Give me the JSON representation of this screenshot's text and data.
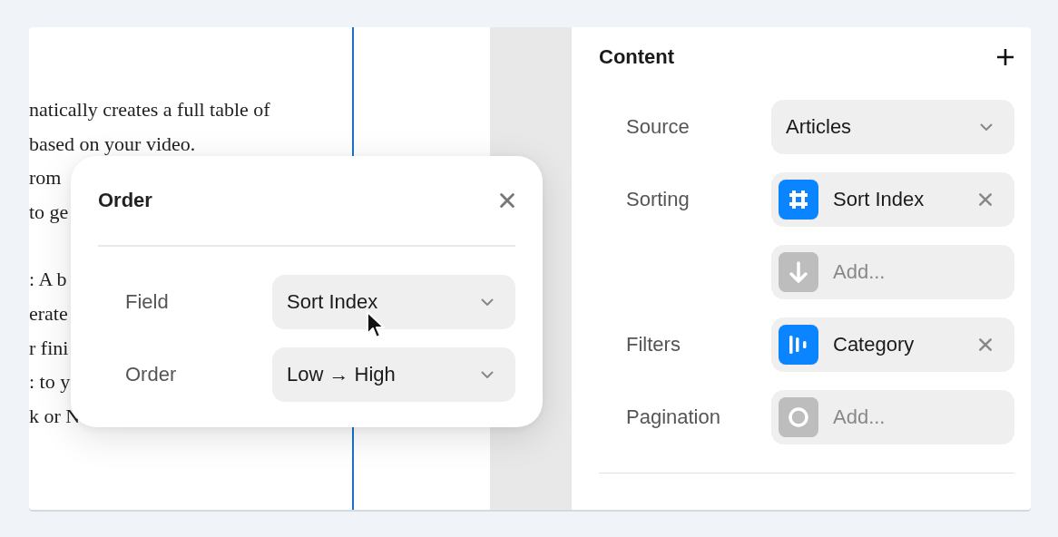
{
  "article": {
    "paragraphs": [
      [
        "natically creates a full table of",
        "based on your video.",
        "rom",
        "to ge"
      ],
      [
        ": A b",
        "erate",
        "r fini",
        ": to y",
        "k or N"
      ]
    ]
  },
  "order_popup": {
    "title": "Order",
    "rows": [
      {
        "label": "Field",
        "value": "Sort Index"
      },
      {
        "label": "Order",
        "value": "Low → High"
      }
    ]
  },
  "content_panel": {
    "title": "Content",
    "rows": [
      {
        "label": "Source",
        "controls": [
          {
            "kind": "select",
            "value": "Articles"
          }
        ]
      },
      {
        "label": "Sorting",
        "controls": [
          {
            "kind": "chip",
            "value": "Sort Index"
          },
          {
            "kind": "add",
            "placeholder": "Add..."
          }
        ]
      },
      {
        "label": "Filters",
        "controls": [
          {
            "kind": "chip",
            "value": "Category"
          }
        ]
      },
      {
        "label": "Pagination",
        "controls": [
          {
            "kind": "add",
            "placeholder": "Add..."
          }
        ]
      }
    ]
  }
}
